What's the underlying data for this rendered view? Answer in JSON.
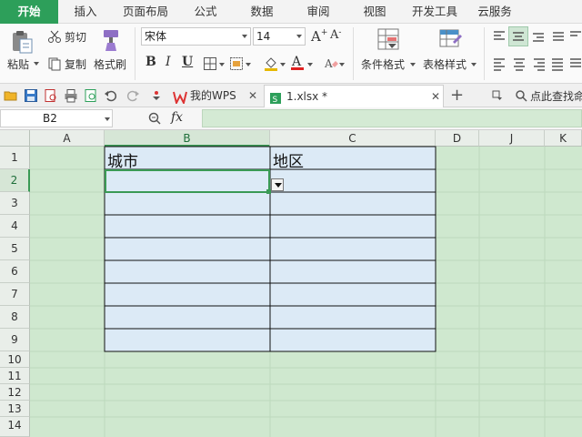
{
  "menu": {
    "tabs": [
      {
        "label": "开始",
        "active": true
      },
      {
        "label": "插入"
      },
      {
        "label": "页面布局"
      },
      {
        "label": "公式"
      },
      {
        "label": "数据"
      },
      {
        "label": "审阅"
      },
      {
        "label": "视图"
      },
      {
        "label": "开发工具"
      },
      {
        "label": "云服务"
      }
    ]
  },
  "ribbon": {
    "paste_label": "粘贴",
    "cut_label": "剪切",
    "copy_label": "复制",
    "format_painter_label": "格式刷",
    "font_name": "宋体",
    "font_size": "14",
    "bold": "B",
    "italic": "I",
    "underline": "U",
    "conditional_format_label": "条件格式",
    "table_style_label": "表格样式"
  },
  "doc_tabs": {
    "home_tab": "我的WPS",
    "file_tab": "1.xlsx *",
    "search_placeholder": "点此查找命"
  },
  "formula_bar": {
    "name_box": "B2",
    "fx_label": "fx",
    "formula": ""
  },
  "sheet": {
    "columns": [
      "A",
      "B",
      "C",
      "D",
      "J",
      "K"
    ],
    "rows": [
      "1",
      "2",
      "3",
      "4",
      "5",
      "6",
      "7",
      "8",
      "9",
      "10",
      "11",
      "12",
      "13",
      "14"
    ],
    "selected_cell": "B2",
    "cells": {
      "B1": "城市",
      "C1": "地区"
    }
  },
  "colors": {
    "accent": "#2d9f5a",
    "grid_bg": "#cfe8cf",
    "table_fill": "#dceaf6"
  }
}
